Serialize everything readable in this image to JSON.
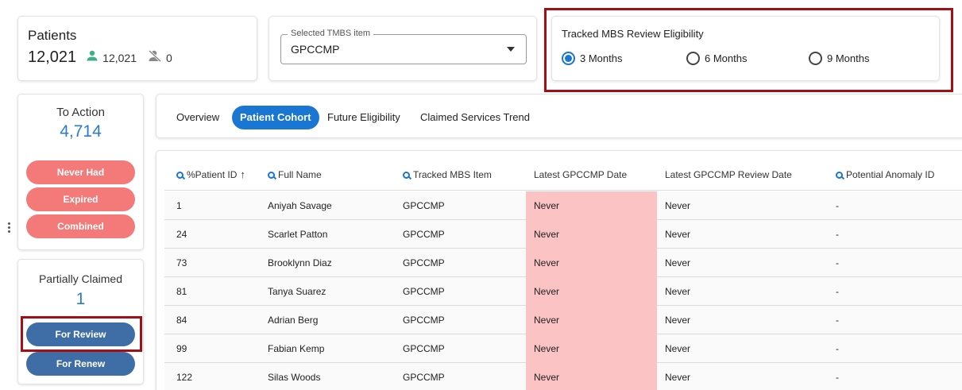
{
  "patients": {
    "title": "Patients",
    "total": "12,021",
    "active_count": "12,021",
    "inactive_count": "0",
    "colors": {
      "active_icon": "#3faf8a",
      "inactive_icon": "#888888"
    }
  },
  "tmbs_select": {
    "label": "Selected TMBS item",
    "value": "GPCCMP"
  },
  "eligibility": {
    "title": "Tracked MBS Review Eligibility",
    "options": [
      {
        "label": "3 Months",
        "checked": true
      },
      {
        "label": "6 Months",
        "checked": false
      },
      {
        "label": "9 Months",
        "checked": false
      }
    ]
  },
  "to_action": {
    "title": "To Action",
    "count": "4,714",
    "buttons": [
      "Never Had",
      "Expired",
      "Combined"
    ]
  },
  "partially_claimed": {
    "title": "Partially Claimed",
    "count": "1",
    "buttons": [
      "For Review",
      "For Renew"
    ]
  },
  "tabs": [
    "Overview",
    "Patient Cohort",
    "Future Eligibility",
    "Claimed Services Trend"
  ],
  "active_tab": "Patient Cohort",
  "table": {
    "columns": [
      "%Patient ID",
      "Full Name",
      "Tracked MBS Item",
      "Latest GPCCMP Date",
      "Latest GPCCMP Review Date",
      "Potential Anomaly ID"
    ],
    "rows": [
      [
        "1",
        "Aniyah Savage",
        "GPCCMP",
        "Never",
        "Never",
        "-"
      ],
      [
        "24",
        "Scarlet Patton",
        "GPCCMP",
        "Never",
        "Never",
        "-"
      ],
      [
        "73",
        "Brooklynn Diaz",
        "GPCCMP",
        "Never",
        "Never",
        "-"
      ],
      [
        "81",
        "Tanya Suarez",
        "GPCCMP",
        "Never",
        "Never",
        "-"
      ],
      [
        "84",
        "Adrian Berg",
        "GPCCMP",
        "Never",
        "Never",
        "-"
      ],
      [
        "99",
        "Fabian Kemp",
        "GPCCMP",
        "Never",
        "Never",
        "-"
      ],
      [
        "122",
        "Silas Woods",
        "GPCCMP",
        "Never",
        "Never",
        "-"
      ]
    ]
  },
  "colors": {
    "accent": "#1976d2",
    "red_pill": "#f47a79",
    "blue_pill": "#3f6ea7",
    "never_cell": "#fbc3c4",
    "highlight": "#a50e14"
  }
}
